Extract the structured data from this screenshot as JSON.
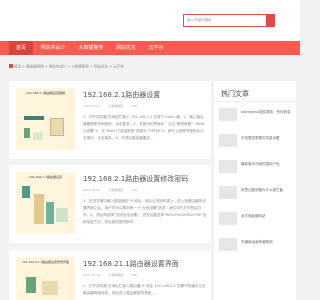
{
  "search": {
    "placeholder": "输入关键词搜索"
  },
  "nav": [
    "首页",
    "网站内设计",
    "大数据服务",
    "网站优化",
    "云平台"
  ],
  "breadcrumb": "首页 > 路由器网络 > 网站内设计 > 大数据服务 > 网站优化 > 云平台",
  "colors": {
    "accent": "#fb5a4e",
    "accent_dark": "#d9453e"
  },
  "articles": [
    {
      "thumb_caption": "192.168.2.1路由器设置图解",
      "title": "192.168.2.1路由器设置",
      "date": "2023-02-07",
      "category": "大数据服务",
      "views": "0TC",
      "excerpt": "1、打开浏览器 在地址栏输入 192.168.2.1 并按下 Enter 键。2、输入路由器管理账号和密码，点击登录。3、在弹出的界面中，点击\"网络参数\"-\"WAN 口设置\"4、在\"WAN 口连接类型\"选择为\" PPPoE\"5、填写上网账号密码后点击保存，点击保存。6、完成后路由器重启..."
    },
    {
      "thumb_caption": "192.168.2.1路由器设置",
      "title": "192.168.2.1路由器设置修改密码",
      "date": "2023-02-07",
      "category": "大数据服务",
      "views": "0TC",
      "excerpt": "1、在浏览器中输入路由器的 IP 地址，然后点击回车键入。进入到路由器的设置界面之后，用户们可以看到有一个\"无线设置\"选项，我们对它打开然后打开。2、然后再选择\"无线安全设置\"，进去后要选择\"WPA-PSK/WPA2-PSK\"这种加密方式，然后修改密码即可..."
    },
    {
      "thumb_caption": "192.168.21.1路由器设置登录界面",
      "title": "192.168.21.1路由器设置界面",
      "date": "2023-02-07",
      "category": "大数据服务",
      "views": "0TC",
      "excerpt": "1、打开浏览器 在地址栏输入路由器 IP 地址 192.168.1.1 如果不知道可以在路由器背面找到，然后进入路由器登录界面..."
    }
  ],
  "sidebar": {
    "title": "热门文章",
    "items": [
      "wordpress插件更新，有何信息",
      "手机要变更要的流量设置",
      "最新版本济南的国际产品",
      "阿里云服务器为什么被拦截",
      "台式电脑做网站",
      "华通南运营商营路测"
    ]
  }
}
